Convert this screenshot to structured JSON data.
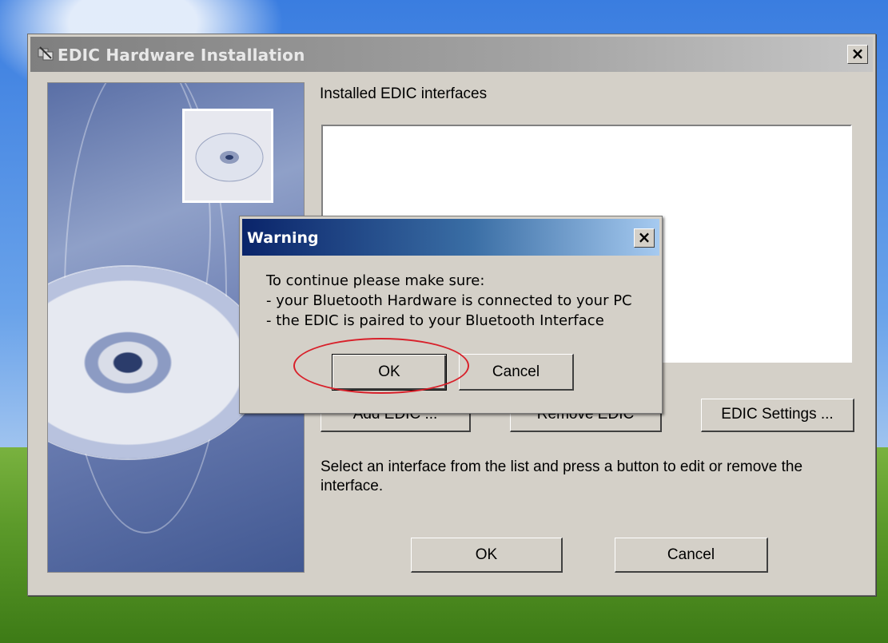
{
  "main_window": {
    "title": "EDIC Hardware Installation",
    "installed_label": "Installed EDIC interfaces",
    "buttons": {
      "add": "Add EDIC ...",
      "remove": "Remove EDIC",
      "settings": "EDIC Settings ..."
    },
    "info_text": "Select an interface from the list and press a button to edit or remove the interface.",
    "ok_label": "OK",
    "cancel_label": "Cancel"
  },
  "warning_dialog": {
    "title": "Warning",
    "message": "To continue please make sure:\n- your Bluetooth Hardware is connected to your PC\n- the EDIC is paired to your Bluetooth Interface",
    "ok_label": "OK",
    "cancel_label": "Cancel"
  },
  "icons": {
    "close": "close-icon",
    "app": "hardware-install-icon",
    "cd": "cd-icon"
  },
  "colors": {
    "warning_title_start": "#0a246a",
    "warning_title_end": "#a6caf0",
    "highlight_ring": "#d8202a"
  }
}
